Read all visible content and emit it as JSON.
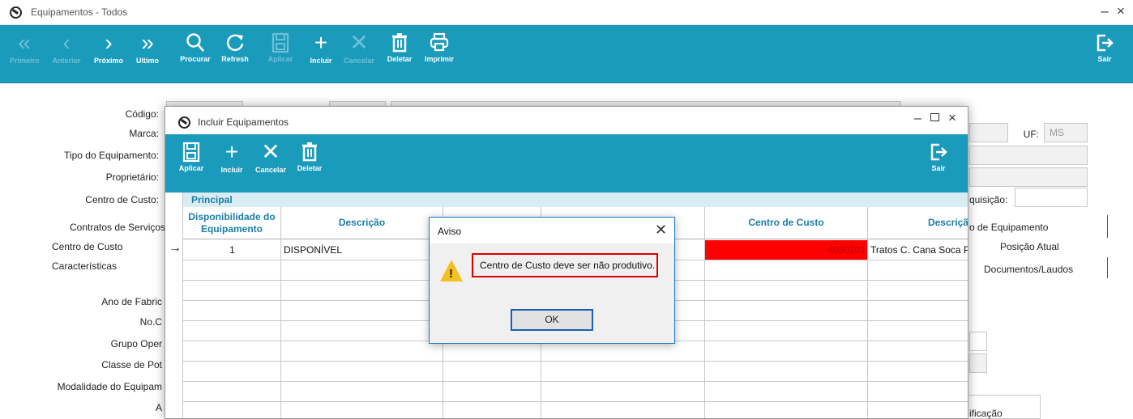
{
  "window": {
    "title": "Equipamentos - Todos",
    "minimize": "–",
    "close": "×"
  },
  "toolbar": {
    "first": "Primeiro",
    "prev": "Anterior",
    "next": "Próximo",
    "last": "Ultimo",
    "search": "Procurar",
    "refresh": "Refresh",
    "apply": "Aplicar",
    "include": "Incluir",
    "cancel": "Cancelar",
    "delete": "Deletar",
    "print": "Imprimir",
    "exit": "Sair"
  },
  "form": {
    "codigo": "Código:",
    "marca": "Marca:",
    "tipo": "Tipo do Equipamento:",
    "proprietario": "Proprietário:",
    "centro_custo": "Centro de Custo:",
    "uf_label": "UF:",
    "uf_value": "MS",
    "aquisicao": "quisição:",
    "tabs_left": [
      "Contratos de Serviços",
      "Centro de Custo",
      "Características"
    ],
    "tabs_right": [
      "o de Equipamento",
      "Posição Atual",
      "Documentos/Laudos"
    ],
    "ano": "Ano de Fabric",
    "noc": "No.C",
    "grupo": "Grupo Oper",
    "classe": "Classe de Pot",
    "modalidade": "Modalidade do Equipam",
    "a": "A",
    "ificacao": "ificação"
  },
  "dialog": {
    "title": "Incluir Equipamentos",
    "toolbar": {
      "apply": "Aplicar",
      "include": "Incluir",
      "cancel": "Cancelar",
      "delete": "Deletar",
      "exit": "Sair"
    },
    "section": "Principal",
    "headers": [
      "Disponibilidade do Equipamento",
      "Descrição",
      "",
      "",
      "Centro de Custo",
      "Descriçã"
    ],
    "row": {
      "disp": "1",
      "desc": "DISPONÍVEL",
      "centro": "4050101",
      "desc2": "Tratos C. Cana Soca P"
    },
    "row_marker": "→"
  },
  "aviso": {
    "title": "Aviso",
    "message": "Centro de Custo deve ser não produtivo.",
    "ok": "OK",
    "close": "✕"
  },
  "colors": {
    "toolbar": "#1a9bbc",
    "error_cell": "#ff0000"
  }
}
